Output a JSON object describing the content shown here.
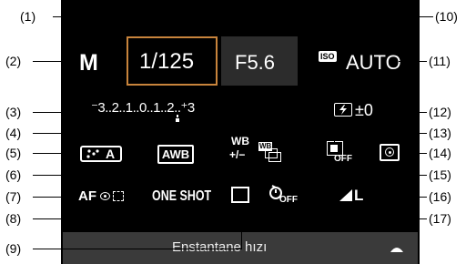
{
  "screen": {
    "mode": "M",
    "shutter_speed": "1/125",
    "aperture": "F5.6",
    "iso_badge": "ISO",
    "iso_value": "AUTO",
    "exposure_scale": "⁻3..2..1..0..1..2..⁺3",
    "flash_comp_value": "±0",
    "picture_style": "A",
    "white_balance": "AWB",
    "wb_correction_top": "WB",
    "wb_correction_bottom": "+/−",
    "wb_bracketing": "WB",
    "auto_lighting_off": "OFF",
    "af_method": "AF",
    "af_operation": "ONE SHOT",
    "self_timer_off": "OFF",
    "image_quality": "L",
    "status_text": "Enstantane hızı"
  },
  "callouts": {
    "c1": "(1)",
    "c2": "(2)",
    "c3": "(3)",
    "c4": "(4)",
    "c5": "(5)",
    "c6": "(6)",
    "c7": "(7)",
    "c8": "(8)",
    "c9": "(9)",
    "c10": "(10)",
    "c11": "(11)",
    "c12": "(12)",
    "c13": "(13)",
    "c14": "(14)",
    "c15": "(15)",
    "c16": "(16)",
    "c17": "(17)"
  },
  "colors": {
    "selection_frame": "#c8843c",
    "screen_background": "#000000",
    "status_bar": "#3a3a3a"
  },
  "icons": {
    "picture_style": "picture-style-icon",
    "wb_correction": "wb-correction-icon",
    "wb_bracketing": "wb-bracketing-icon",
    "auto_lighting": "auto-lighting-optimizer-icon",
    "metering": "metering-mode-icon",
    "flash_comp": "flash-exposure-comp-icon",
    "drive": "drive-mode-icon",
    "self_timer": "self-timer-icon",
    "quality": "image-quality-icon"
  }
}
